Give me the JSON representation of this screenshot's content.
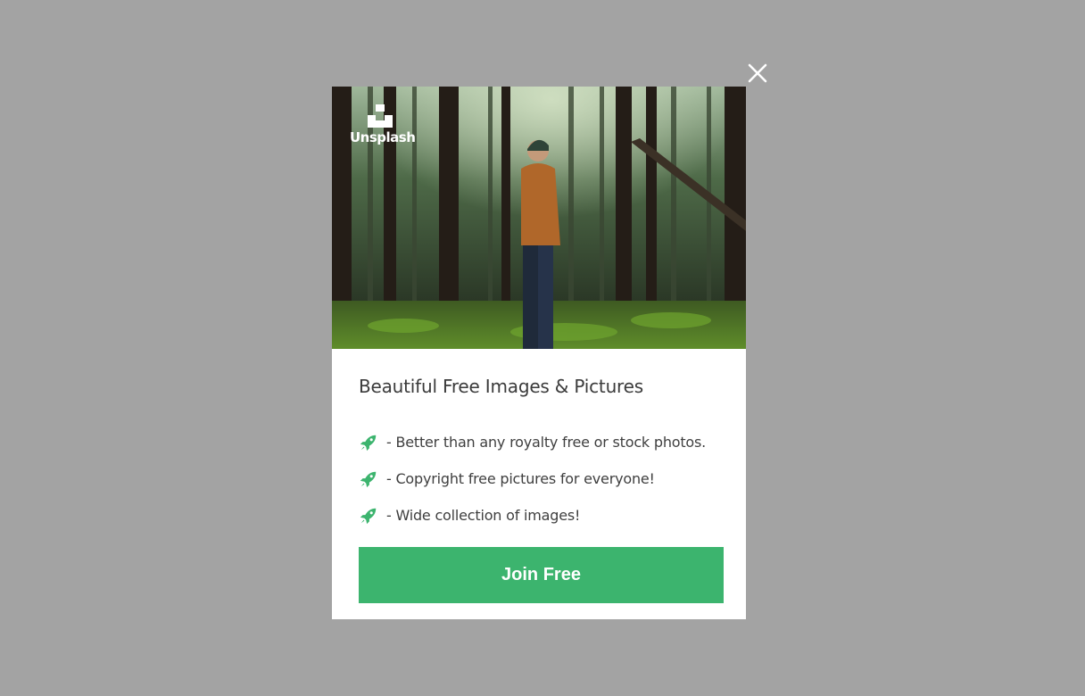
{
  "overlay": {
    "background": "#a3a3a3"
  },
  "close_button": {
    "icon": "close-icon",
    "color": "#ffffff"
  },
  "modal": {
    "hero": {
      "image_subject": "forest-photo",
      "logo": {
        "icon": "unsplash-logo-icon",
        "text": "Unsplash"
      }
    },
    "title": "Beautiful Free Images & Pictures",
    "features": [
      {
        "icon": "rocket-icon",
        "text": "- Better than any royalty free or stock photos."
      },
      {
        "icon": "rocket-icon",
        "text": "- Copyright free pictures for everyone!"
      },
      {
        "icon": "rocket-icon",
        "text": "- Wide collection of images!"
      }
    ],
    "cta": {
      "label": "Join Free",
      "color": "#3cb46e"
    }
  },
  "colors": {
    "accent": "#3cb46e",
    "text": "#3b3b3b",
    "modal_bg": "#ffffff"
  }
}
